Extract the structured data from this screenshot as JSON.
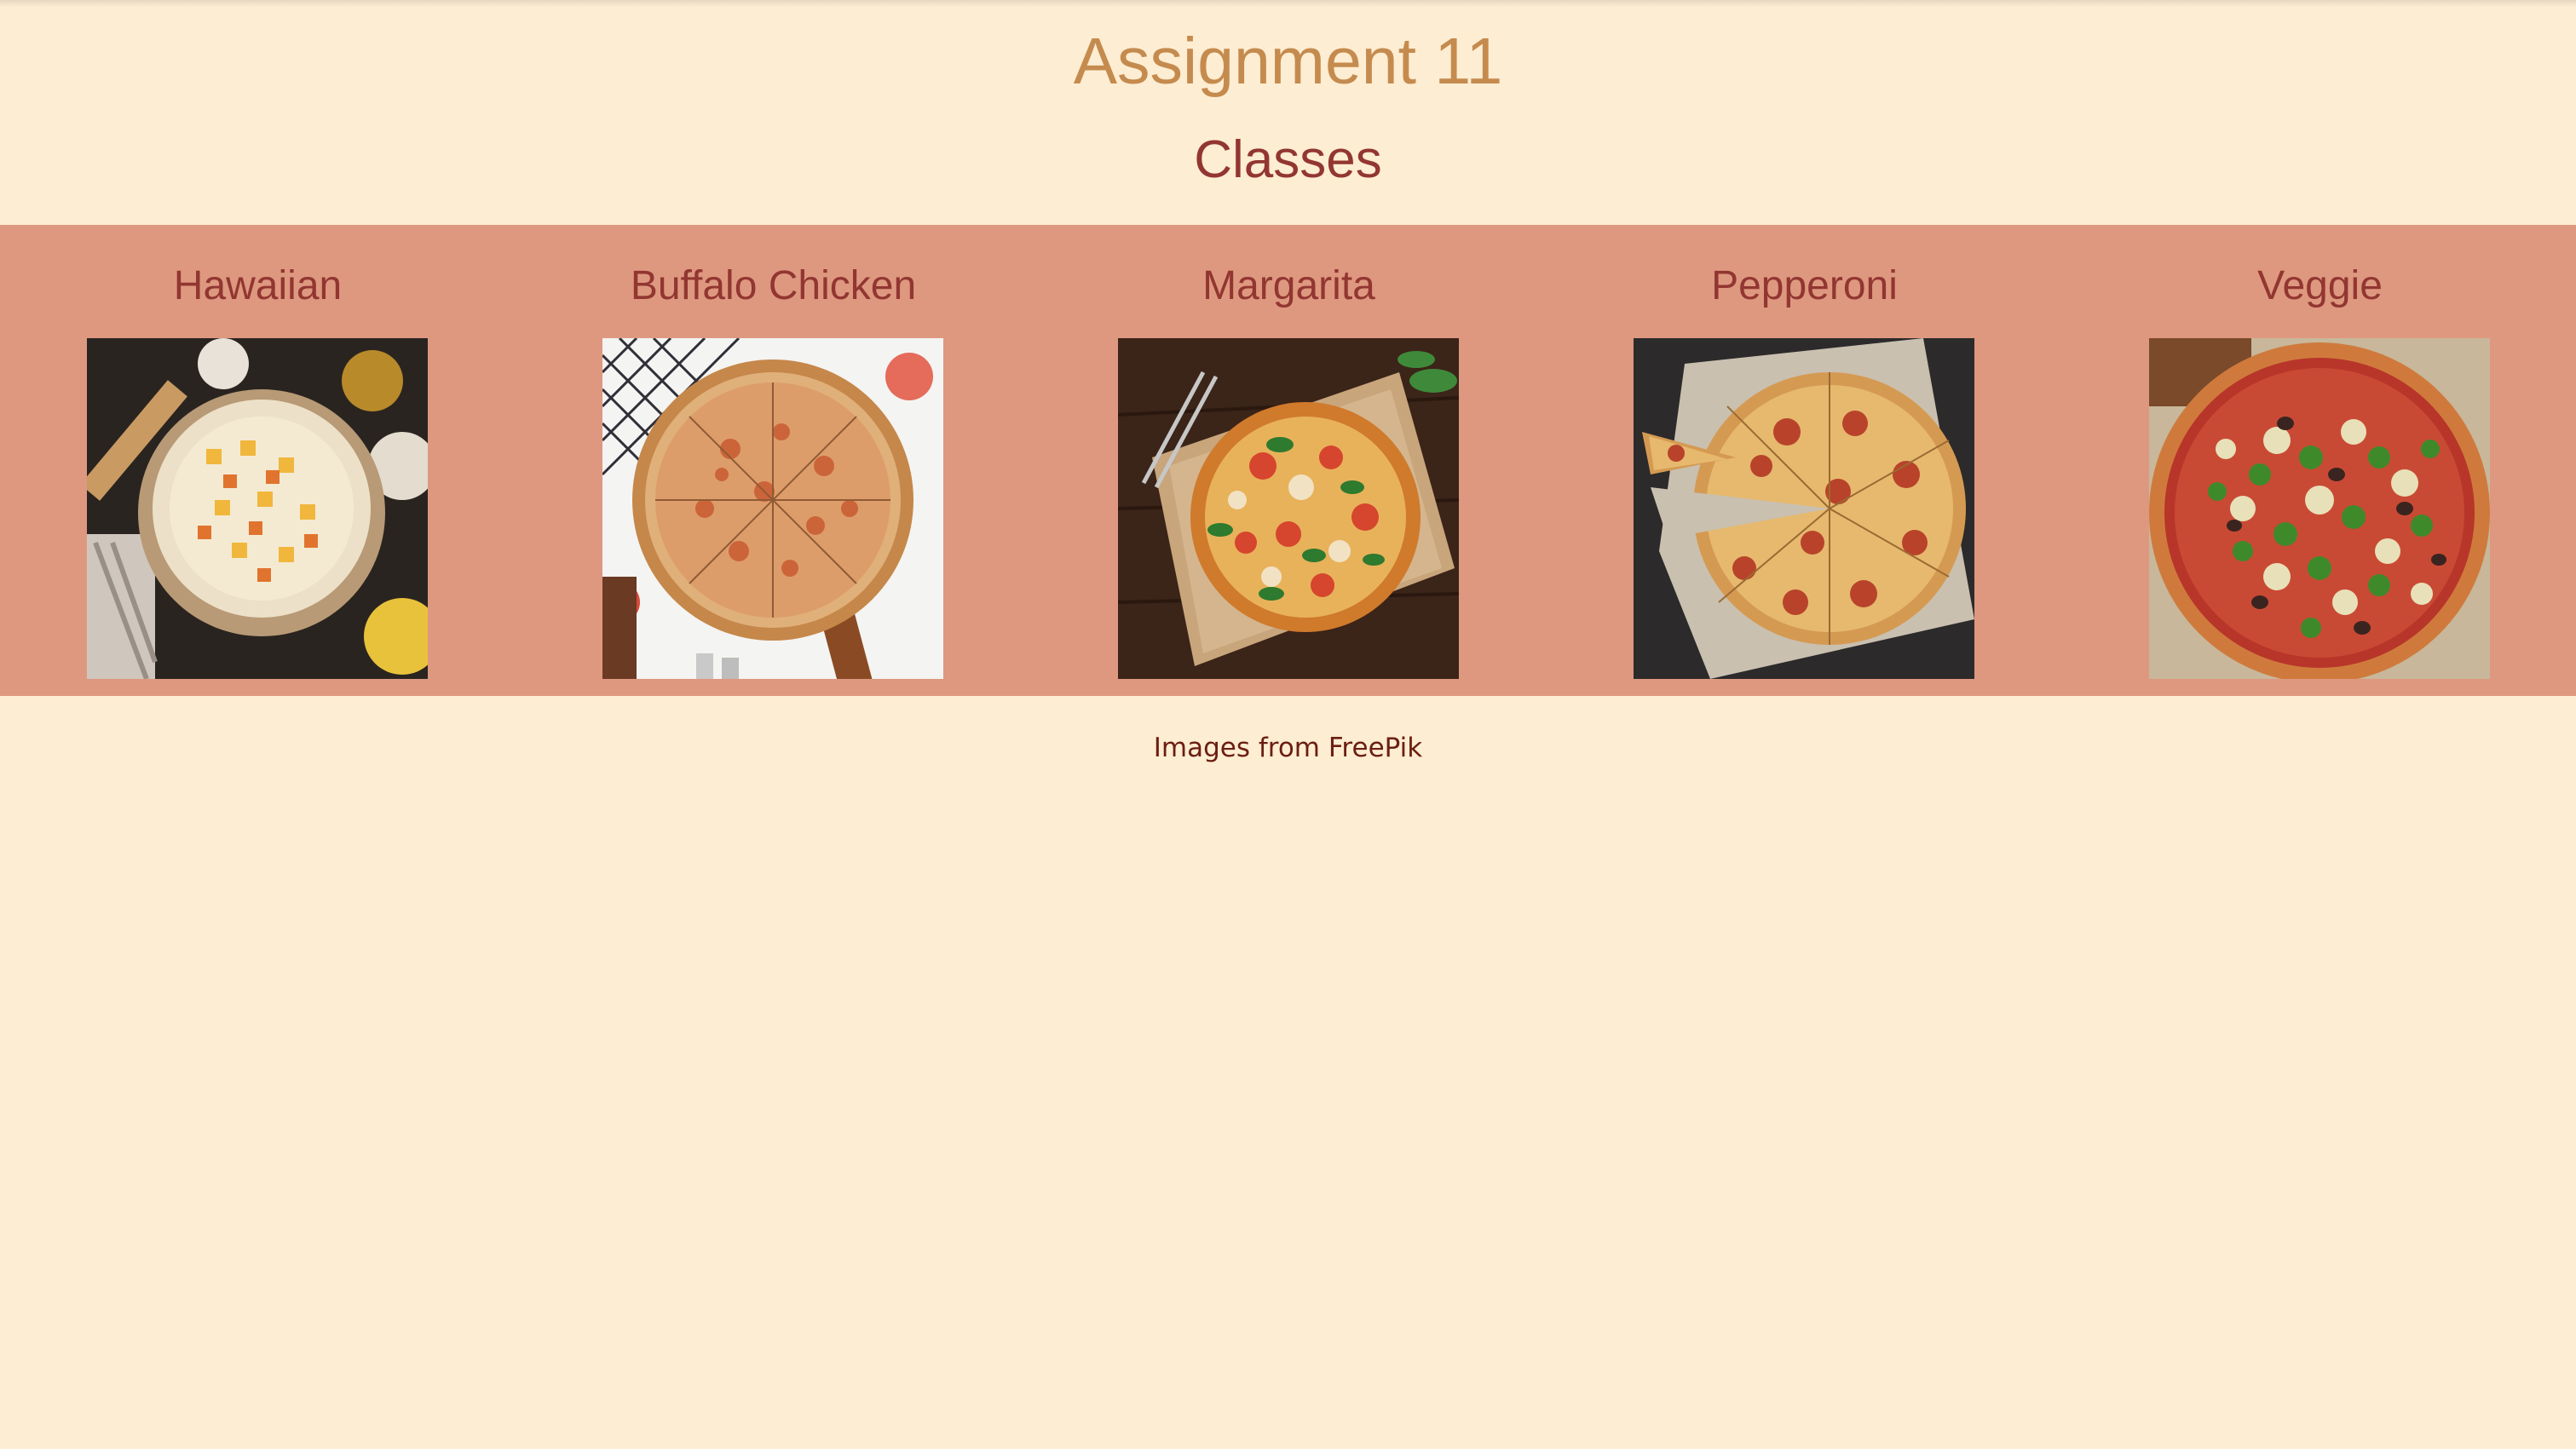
{
  "header": {
    "title": "Assignment 11",
    "subtitle": "Classes"
  },
  "pizzas": [
    {
      "name": "Hawaiian",
      "image": "hawaiian-pizza-photo"
    },
    {
      "name": "Buffalo Chicken",
      "image": "buffalo-chicken-pizza-photo"
    },
    {
      "name": "Margarita",
      "image": "margarita-pizza-photo"
    },
    {
      "name": "Pepperoni",
      "image": "pepperoni-pizza-photo"
    },
    {
      "name": "Veggie",
      "image": "veggie-pizza-photo"
    }
  ],
  "footer": {
    "credit": "Images from FreePik"
  },
  "colors": {
    "background": "#fdedd2",
    "band": "#de9880",
    "title": "#c58b4e",
    "heading": "#923631",
    "credit": "#6b1e12"
  }
}
